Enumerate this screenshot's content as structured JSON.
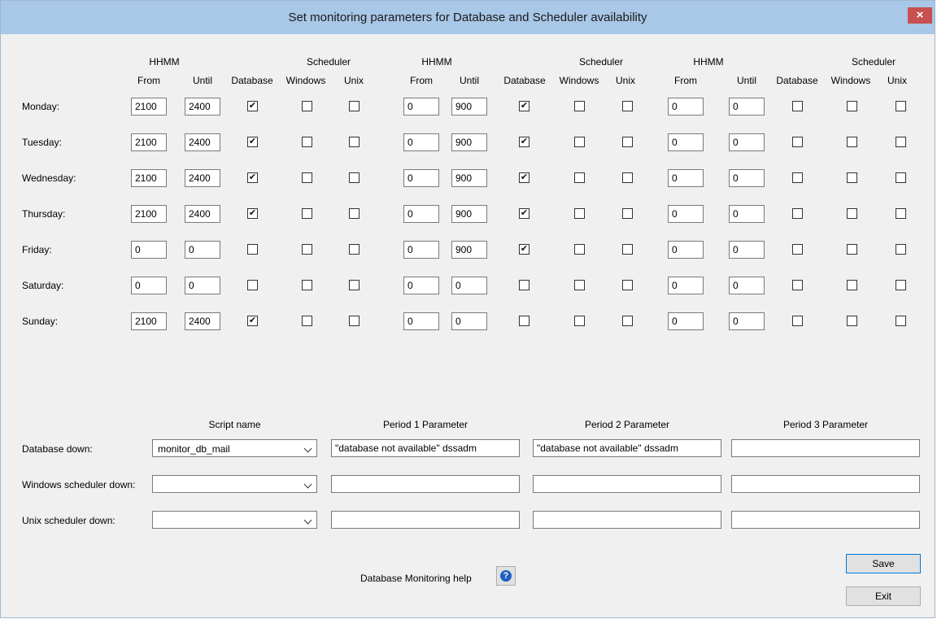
{
  "window": {
    "title": "Set monitoring parameters for Database and Scheduler availability",
    "close_glyph": "×"
  },
  "schedule": {
    "periods": [
      {
        "hhmm": "HHMM",
        "from": "From",
        "until": "Until",
        "scheduler": "Scheduler",
        "database": "Database",
        "windows": "Windows",
        "unix": "Unix"
      },
      {
        "hhmm": "HHMM",
        "from": "From",
        "until": "Until",
        "scheduler": "Scheduler",
        "database": "Database",
        "windows": "Windows",
        "unix": "Unix"
      },
      {
        "hhmm": "HHMM",
        "from": "From",
        "until": "Until",
        "scheduler": "Scheduler",
        "database": "Database",
        "windows": "Windows",
        "unix": "Unix"
      }
    ],
    "days": [
      {
        "label": "Monday:",
        "periods": [
          {
            "from": "2100",
            "until": "2400",
            "database": true,
            "windows": false,
            "unix": false
          },
          {
            "from": "0",
            "until": "900",
            "database": true,
            "windows": false,
            "unix": false
          },
          {
            "from": "0",
            "until": "0",
            "database": false,
            "windows": false,
            "unix": false
          }
        ]
      },
      {
        "label": "Tuesday:",
        "periods": [
          {
            "from": "2100",
            "until": "2400",
            "database": true,
            "windows": false,
            "unix": false
          },
          {
            "from": "0",
            "until": "900",
            "database": true,
            "windows": false,
            "unix": false
          },
          {
            "from": "0",
            "until": "0",
            "database": false,
            "windows": false,
            "unix": false
          }
        ]
      },
      {
        "label": "Wednesday:",
        "periods": [
          {
            "from": "2100",
            "until": "2400",
            "database": true,
            "windows": false,
            "unix": false
          },
          {
            "from": "0",
            "until": "900",
            "database": true,
            "windows": false,
            "unix": false
          },
          {
            "from": "0",
            "until": "0",
            "database": false,
            "windows": false,
            "unix": false
          }
        ]
      },
      {
        "label": "Thursday:",
        "periods": [
          {
            "from": "2100",
            "until": "2400",
            "database": true,
            "windows": false,
            "unix": false
          },
          {
            "from": "0",
            "until": "900",
            "database": true,
            "windows": false,
            "unix": false
          },
          {
            "from": "0",
            "until": "0",
            "database": false,
            "windows": false,
            "unix": false
          }
        ]
      },
      {
        "label": "Friday:",
        "periods": [
          {
            "from": "0",
            "until": "0",
            "database": false,
            "windows": false,
            "unix": false
          },
          {
            "from": "0",
            "until": "900",
            "database": true,
            "windows": false,
            "unix": false
          },
          {
            "from": "0",
            "until": "0",
            "database": false,
            "windows": false,
            "unix": false
          }
        ]
      },
      {
        "label": "Saturday:",
        "periods": [
          {
            "from": "0",
            "until": "0",
            "database": false,
            "windows": false,
            "unix": false
          },
          {
            "from": "0",
            "until": "0",
            "database": false,
            "windows": false,
            "unix": false
          },
          {
            "from": "0",
            "until": "0",
            "database": false,
            "windows": false,
            "unix": false
          }
        ]
      },
      {
        "label": "Sunday:",
        "periods": [
          {
            "from": "2100",
            "until": "2400",
            "database": true,
            "windows": false,
            "unix": false
          },
          {
            "from": "0",
            "until": "0",
            "database": false,
            "windows": false,
            "unix": false
          },
          {
            "from": "0",
            "until": "0",
            "database": false,
            "windows": false,
            "unix": false
          }
        ]
      }
    ]
  },
  "actions": {
    "headers": {
      "script_name": "Script name",
      "period1": "Period 1 Parameter",
      "period2": "Period 2 Parameter",
      "period3": "Period 3 Parameter"
    },
    "rows": [
      {
        "label": "Database down:",
        "script": "monitor_db_mail",
        "p1": "\"database not available\" dssadm",
        "p2": "\"database not available\" dssadm",
        "p3": ""
      },
      {
        "label": "Windows scheduler down:",
        "script": "",
        "p1": "",
        "p2": "",
        "p3": ""
      },
      {
        "label": "Unix scheduler down:",
        "script": "",
        "p1": "",
        "p2": "",
        "p3": ""
      }
    ]
  },
  "footer": {
    "help_label": "Database Monitoring help",
    "help_icon": "help-question-icon",
    "save_label": "Save",
    "exit_label": "Exit"
  },
  "colors": {
    "titlebar": "#a9c7e7",
    "close": "#c75050",
    "background": "#f0f0f0"
  }
}
